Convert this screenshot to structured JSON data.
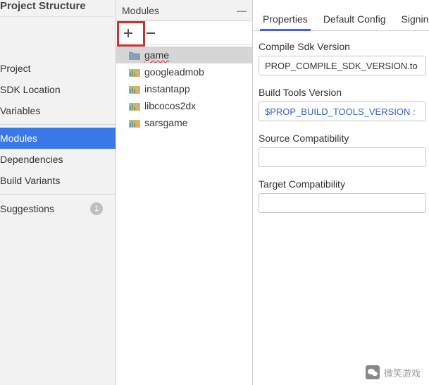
{
  "window_title": "Project Structure",
  "sidebar": {
    "items": [
      {
        "label": "Project"
      },
      {
        "label": "SDK Location"
      },
      {
        "label": "Variables"
      },
      {
        "label": "Modules",
        "selected": true
      },
      {
        "label": "Dependencies"
      },
      {
        "label": "Build Variants"
      }
    ],
    "suggestions_label": "Suggestions",
    "suggestions_count": "1"
  },
  "modules": {
    "header": "Modules",
    "items": [
      {
        "name": "game",
        "kind": "folder",
        "selected": true,
        "squiggle": true
      },
      {
        "name": "googleadmob",
        "kind": "module"
      },
      {
        "name": "instantapp",
        "kind": "module"
      },
      {
        "name": "libcocos2dx",
        "kind": "module"
      },
      {
        "name": "sarsgame",
        "kind": "module"
      }
    ]
  },
  "tabs": [
    {
      "label": "Properties",
      "active": true
    },
    {
      "label": "Default Config"
    },
    {
      "label": "Signing"
    }
  ],
  "form": {
    "compile_sdk_label": "Compile Sdk Version",
    "compile_sdk_value": "PROP_COMPILE_SDK_VERSION.to",
    "build_tools_label": "Build Tools Version",
    "build_tools_value": "$PROP_BUILD_TOOLS_VERSION :",
    "source_compat_label": "Source Compatibility",
    "source_compat_value": "",
    "target_compat_label": "Target Compatibility",
    "target_compat_value": ""
  },
  "watermark": "微笑游戏"
}
